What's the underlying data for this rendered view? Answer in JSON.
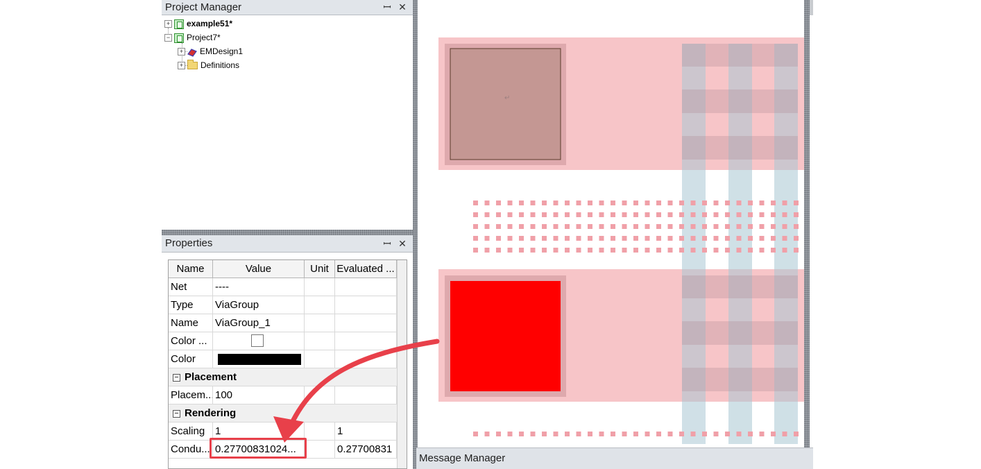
{
  "project_manager": {
    "title": "Project Manager",
    "pin_glyph": "ꟷ",
    "close_glyph": "✕",
    "tree": [
      {
        "label": "example51*",
        "bold": true,
        "icon": "project-icon",
        "expander": "+"
      },
      {
        "label": "Project7*",
        "bold": false,
        "icon": "project-icon",
        "expander": "−"
      },
      {
        "label": "EMDesign1",
        "bold": false,
        "icon": "em-design-icon",
        "expander": "+"
      },
      {
        "label": "Definitions",
        "bold": false,
        "icon": "folder-icon",
        "expander": "+"
      }
    ]
  },
  "properties": {
    "title": "Properties",
    "columns": [
      "Name",
      "Value",
      "Unit",
      "Evaluated ..."
    ],
    "rows": [
      {
        "name": "Net",
        "value": "----",
        "unit": "",
        "evaluated": ""
      },
      {
        "name": "Type",
        "value": "ViaGroup",
        "unit": "",
        "evaluated": ""
      },
      {
        "name": "Name",
        "value": "ViaGroup_1",
        "unit": "",
        "evaluated": ""
      },
      {
        "name": "Color ...",
        "value": "",
        "unit": "",
        "evaluated": ""
      },
      {
        "name": "Color",
        "value": "",
        "unit": "",
        "evaluated": ""
      }
    ],
    "section_placement": "Placement",
    "placement_row": {
      "name": "Placem...",
      "value": "100",
      "unit": "",
      "evaluated": ""
    },
    "section_rendering": "Rendering",
    "scaling_row": {
      "name": "Scaling",
      "value": "1",
      "unit": "",
      "evaluated": "1"
    },
    "conduct_row": {
      "name": "Condu...",
      "value": "0.27700831024...",
      "unit": "",
      "evaluated": "0.27700831"
    },
    "collapse_glyph": "−",
    "color_swatch": "#000000"
  },
  "message_manager": {
    "title": "Message Manager"
  },
  "colors": {
    "annotation_red": "#e8404a",
    "pad_red": "#ff0000",
    "pad_brown": "#c49793",
    "plane_pink": "#f7c5c8",
    "via_pink": "#f0a0a8",
    "strip_blue": "#a9c7d3"
  }
}
